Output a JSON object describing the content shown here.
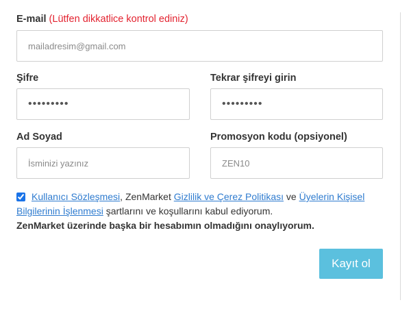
{
  "email": {
    "label": "E-mail",
    "warning": "(Lütfen dikkatlice kontrol ediniz)",
    "placeholder": "mailadresim@gmail.com"
  },
  "password": {
    "label": "Şifre",
    "value": "passwrd12"
  },
  "password_repeat": {
    "label": "Tekrar şifreyi girin",
    "value": "passwrd12"
  },
  "fullname": {
    "label": "Ad Soyad",
    "placeholder": "İsminizi yazınız"
  },
  "promo": {
    "label": "Promosyon kodu (opsiyonel)",
    "placeholder": "ZEN10"
  },
  "consent": {
    "checked": true,
    "link_terms": "Kullanıcı Sözleşmesi",
    "text_1": ", ZenMarket ",
    "link_privacy": "Gizlilik ve Çerez Politikası",
    "text_2": " ve ",
    "link_data": "Üyelerin Kişisel Bilgilerinin İşlenmesi",
    "text_3": " şartlarını ve koşullarını kabul ediyorum.",
    "confirm": "ZenMarket üzerinde başka bir hesabımın olmadığını onaylıyorum."
  },
  "submit_label": "Kayıt ol"
}
